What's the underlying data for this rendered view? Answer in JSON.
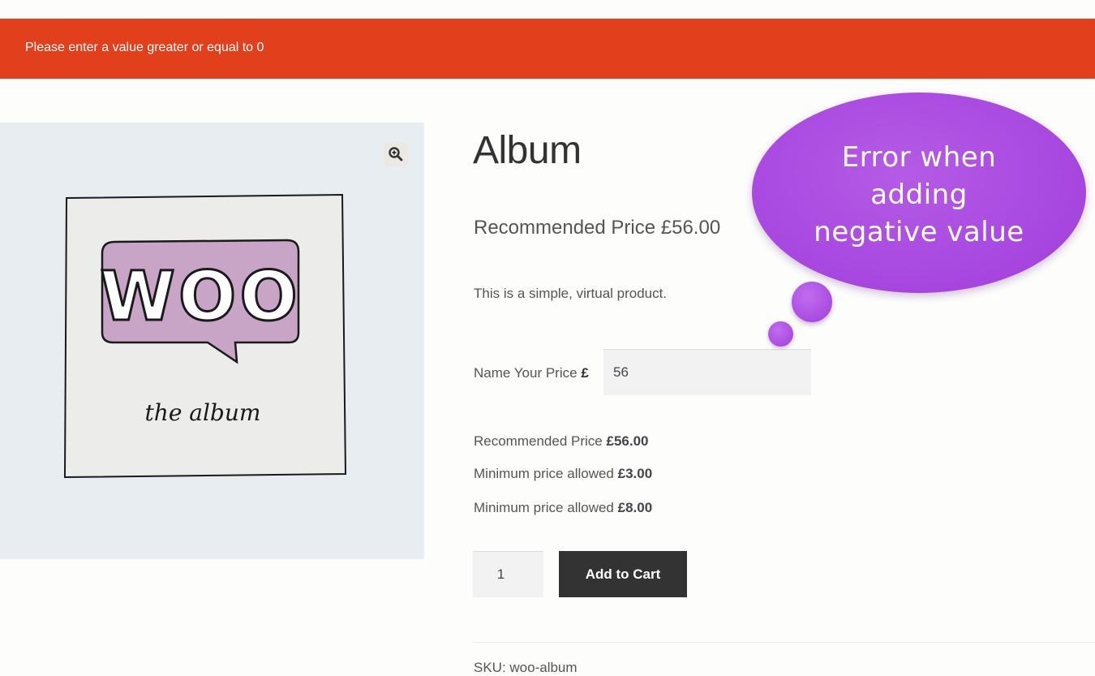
{
  "notice": {
    "error_text": "Please enter a value greater or equal to 0",
    "color": "#e2401c"
  },
  "gallery": {
    "zoom_icon": "zoom-in-icon",
    "image_text": {
      "logo": "WOO",
      "subtitle": "the album"
    }
  },
  "product": {
    "title": "Album",
    "recommended_price_heading": "Recommended Price £56.00",
    "description": "This is a simple, virtual product.",
    "name_your_price": {
      "label": "Name Your Price",
      "currency": "£",
      "value": "56"
    },
    "info": [
      {
        "label": "Recommended Price",
        "value": "£56.00"
      },
      {
        "label": "Minimum price allowed",
        "value": "£3.00"
      },
      {
        "label": "Minimum price allowed",
        "value": "£8.00"
      }
    ],
    "quantity": "1",
    "add_to_cart_label": "Add to Cart",
    "sku_text": "SKU: woo-album"
  },
  "callout": {
    "lines": [
      "Error when",
      "adding",
      "negative value"
    ],
    "color": "#a646df"
  }
}
